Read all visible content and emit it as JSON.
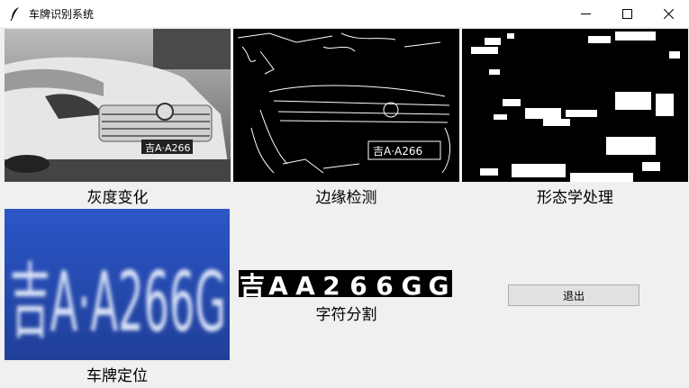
{
  "window": {
    "title": "车牌识别系统",
    "icons": [
      "feather-icon",
      "minimize-icon",
      "maximize-icon",
      "close-icon"
    ]
  },
  "panels": {
    "gray": {
      "caption": "灰度变化"
    },
    "edge": {
      "caption": "边缘检测"
    },
    "morph": {
      "caption": "形态学处理"
    },
    "locate": {
      "caption": "车牌定位"
    },
    "segment": {
      "caption": "字符分割"
    }
  },
  "plate": {
    "text": "吉A·A266G"
  },
  "exit_button": {
    "label": "退出"
  }
}
